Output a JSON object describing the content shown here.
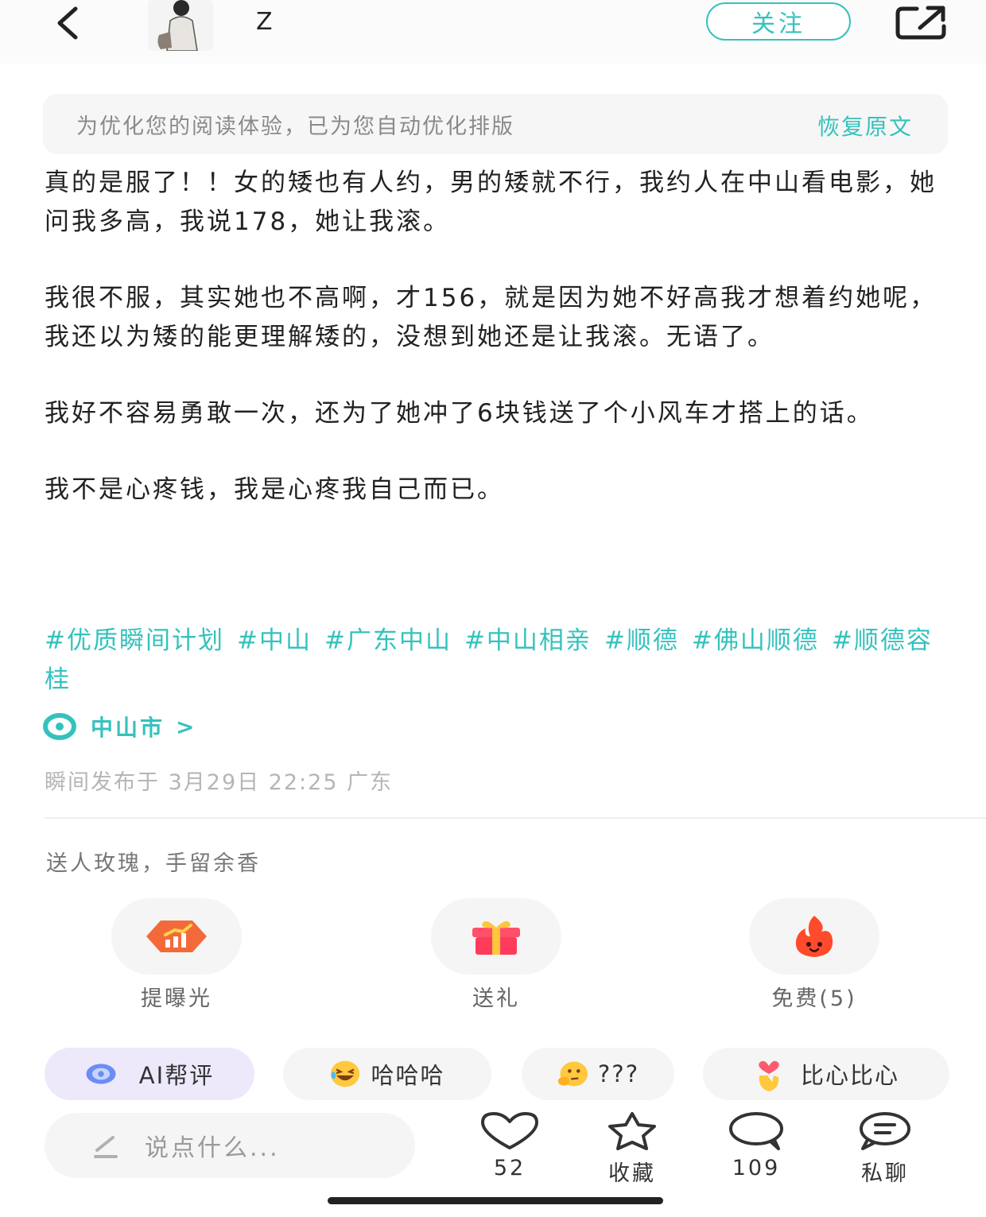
{
  "header": {
    "username": "Z",
    "follow_label": "关注"
  },
  "notice": {
    "text": "为优化您的阅读体验，已为您自动优化排版",
    "restore_label": "恢复原文"
  },
  "post": {
    "paragraphs": [
      "真的是服了！！女的矮也有人约，男的矮就不行，我约人在中山看电影，她问我多高，我说178，她让我滚。",
      "我很不服，其实她也不高啊，才156，就是因为她不好高我才想着约她呢，我还以为矮的能更理解矮的，没想到她还是让我滚。无语了。",
      "我好不容易勇敢一次，还为了她冲了6块钱送了个小风车才搭上的话。",
      "我不是心疼钱，我是心疼我自己而已。"
    ],
    "tags": [
      "#优质瞬间计划",
      "#中山",
      "#广东中山",
      "#中山相亲",
      "#顺德",
      "#佛山顺德",
      "#顺德容桂"
    ],
    "location": "中山市",
    "publish_info": "瞬间发布于 3月29日 22:25 广东"
  },
  "gift": {
    "title": "送人玫瑰，手留余香",
    "actions": [
      {
        "label": "提曝光",
        "icon": "boost-icon"
      },
      {
        "label": "送礼",
        "icon": "gift-icon"
      },
      {
        "label": "免费(5)",
        "icon": "fire-icon"
      }
    ]
  },
  "quick_replies": [
    {
      "label": "AI帮评",
      "icon": "ai-icon"
    },
    {
      "label": "哈哈哈",
      "icon": "laughing-emoji-icon"
    },
    {
      "label": "???",
      "icon": "thinking-emoji-icon"
    },
    {
      "label": "比心比心",
      "icon": "heart-hand-icon"
    }
  ],
  "bottom_bar": {
    "comment_placeholder": "说点什么...",
    "like_count": "52",
    "collect_label": "收藏",
    "comment_count": "109",
    "message_label": "私聊"
  },
  "colors": {
    "accent": "#35c2bd",
    "text": "#222222",
    "muted": "#8a8a8a",
    "chip_bg": "#f5f5f5"
  }
}
